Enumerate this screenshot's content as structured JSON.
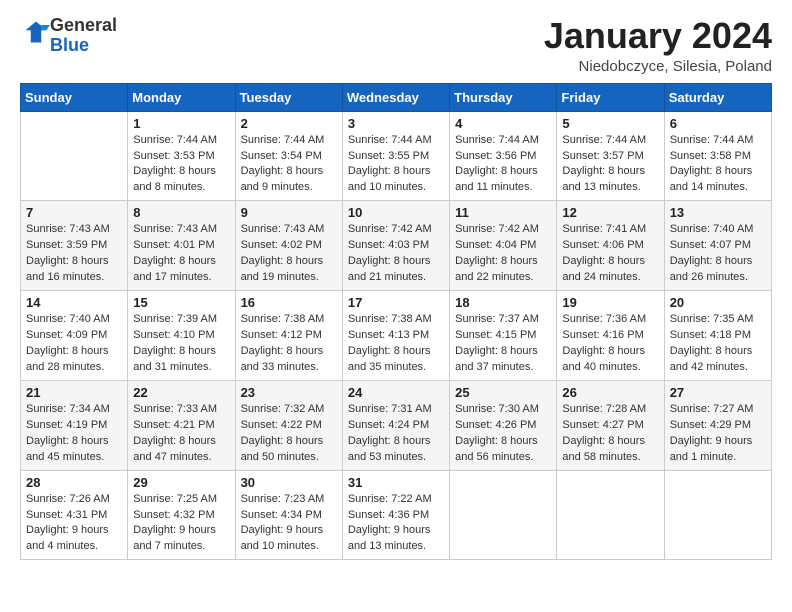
{
  "header": {
    "logo_general": "General",
    "logo_blue": "Blue",
    "month": "January 2024",
    "location": "Niedobczyce, Silesia, Poland"
  },
  "weekdays": [
    "Sunday",
    "Monday",
    "Tuesday",
    "Wednesday",
    "Thursday",
    "Friday",
    "Saturday"
  ],
  "weeks": [
    [
      {
        "day": "",
        "sunrise": "",
        "sunset": "",
        "daylight": ""
      },
      {
        "day": "1",
        "sunrise": "7:44 AM",
        "sunset": "3:53 PM",
        "daylight": "8 hours and 8 minutes."
      },
      {
        "day": "2",
        "sunrise": "7:44 AM",
        "sunset": "3:54 PM",
        "daylight": "8 hours and 9 minutes."
      },
      {
        "day": "3",
        "sunrise": "7:44 AM",
        "sunset": "3:55 PM",
        "daylight": "8 hours and 10 minutes."
      },
      {
        "day": "4",
        "sunrise": "7:44 AM",
        "sunset": "3:56 PM",
        "daylight": "8 hours and 11 minutes."
      },
      {
        "day": "5",
        "sunrise": "7:44 AM",
        "sunset": "3:57 PM",
        "daylight": "8 hours and 13 minutes."
      },
      {
        "day": "6",
        "sunrise": "7:44 AM",
        "sunset": "3:58 PM",
        "daylight": "8 hours and 14 minutes."
      }
    ],
    [
      {
        "day": "7",
        "sunrise": "7:43 AM",
        "sunset": "3:59 PM",
        "daylight": "8 hours and 16 minutes."
      },
      {
        "day": "8",
        "sunrise": "7:43 AM",
        "sunset": "4:01 PM",
        "daylight": "8 hours and 17 minutes."
      },
      {
        "day": "9",
        "sunrise": "7:43 AM",
        "sunset": "4:02 PM",
        "daylight": "8 hours and 19 minutes."
      },
      {
        "day": "10",
        "sunrise": "7:42 AM",
        "sunset": "4:03 PM",
        "daylight": "8 hours and 21 minutes."
      },
      {
        "day": "11",
        "sunrise": "7:42 AM",
        "sunset": "4:04 PM",
        "daylight": "8 hours and 22 minutes."
      },
      {
        "day": "12",
        "sunrise": "7:41 AM",
        "sunset": "4:06 PM",
        "daylight": "8 hours and 24 minutes."
      },
      {
        "day": "13",
        "sunrise": "7:40 AM",
        "sunset": "4:07 PM",
        "daylight": "8 hours and 26 minutes."
      }
    ],
    [
      {
        "day": "14",
        "sunrise": "7:40 AM",
        "sunset": "4:09 PM",
        "daylight": "8 hours and 28 minutes."
      },
      {
        "day": "15",
        "sunrise": "7:39 AM",
        "sunset": "4:10 PM",
        "daylight": "8 hours and 31 minutes."
      },
      {
        "day": "16",
        "sunrise": "7:38 AM",
        "sunset": "4:12 PM",
        "daylight": "8 hours and 33 minutes."
      },
      {
        "day": "17",
        "sunrise": "7:38 AM",
        "sunset": "4:13 PM",
        "daylight": "8 hours and 35 minutes."
      },
      {
        "day": "18",
        "sunrise": "7:37 AM",
        "sunset": "4:15 PM",
        "daylight": "8 hours and 37 minutes."
      },
      {
        "day": "19",
        "sunrise": "7:36 AM",
        "sunset": "4:16 PM",
        "daylight": "8 hours and 40 minutes."
      },
      {
        "day": "20",
        "sunrise": "7:35 AM",
        "sunset": "4:18 PM",
        "daylight": "8 hours and 42 minutes."
      }
    ],
    [
      {
        "day": "21",
        "sunrise": "7:34 AM",
        "sunset": "4:19 PM",
        "daylight": "8 hours and 45 minutes."
      },
      {
        "day": "22",
        "sunrise": "7:33 AM",
        "sunset": "4:21 PM",
        "daylight": "8 hours and 47 minutes."
      },
      {
        "day": "23",
        "sunrise": "7:32 AM",
        "sunset": "4:22 PM",
        "daylight": "8 hours and 50 minutes."
      },
      {
        "day": "24",
        "sunrise": "7:31 AM",
        "sunset": "4:24 PM",
        "daylight": "8 hours and 53 minutes."
      },
      {
        "day": "25",
        "sunrise": "7:30 AM",
        "sunset": "4:26 PM",
        "daylight": "8 hours and 56 minutes."
      },
      {
        "day": "26",
        "sunrise": "7:28 AM",
        "sunset": "4:27 PM",
        "daylight": "8 hours and 58 minutes."
      },
      {
        "day": "27",
        "sunrise": "7:27 AM",
        "sunset": "4:29 PM",
        "daylight": "9 hours and 1 minute."
      }
    ],
    [
      {
        "day": "28",
        "sunrise": "7:26 AM",
        "sunset": "4:31 PM",
        "daylight": "9 hours and 4 minutes."
      },
      {
        "day": "29",
        "sunrise": "7:25 AM",
        "sunset": "4:32 PM",
        "daylight": "9 hours and 7 minutes."
      },
      {
        "day": "30",
        "sunrise": "7:23 AM",
        "sunset": "4:34 PM",
        "daylight": "9 hours and 10 minutes."
      },
      {
        "day": "31",
        "sunrise": "7:22 AM",
        "sunset": "4:36 PM",
        "daylight": "9 hours and 13 minutes."
      },
      {
        "day": "",
        "sunrise": "",
        "sunset": "",
        "daylight": ""
      },
      {
        "day": "",
        "sunrise": "",
        "sunset": "",
        "daylight": ""
      },
      {
        "day": "",
        "sunrise": "",
        "sunset": "",
        "daylight": ""
      }
    ]
  ]
}
